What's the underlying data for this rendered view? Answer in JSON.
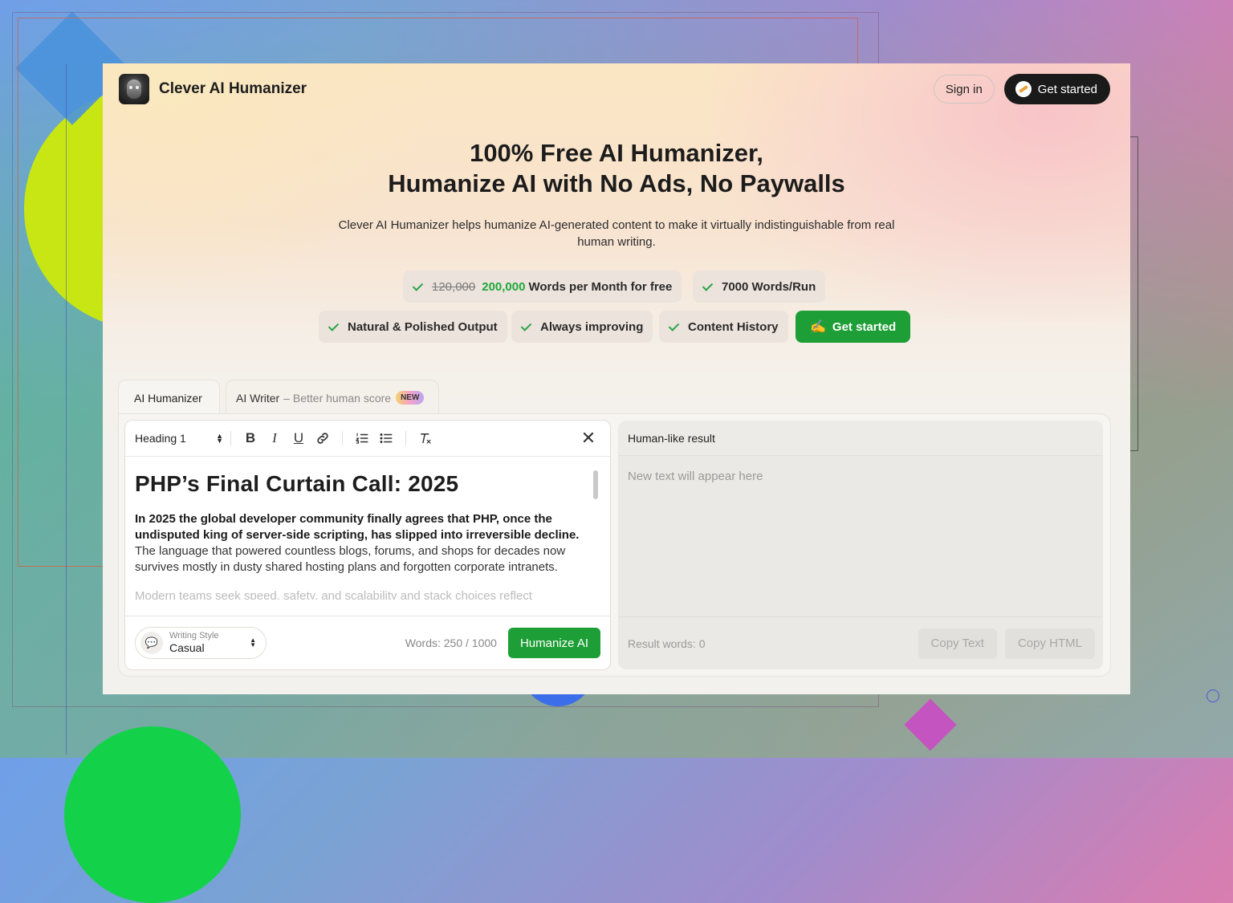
{
  "header": {
    "brand": "Clever AI Humanizer",
    "sign_in": "Sign in",
    "get_started": "Get started"
  },
  "hero": {
    "title_line1": "100% Free AI Humanizer,",
    "title_line2": "Humanize AI with No Ads, No Paywalls",
    "subtitle": "Clever AI Humanizer helps humanize AI-generated content to make it virtually indistinguishable from real human writing."
  },
  "features": {
    "words_old": "120,000",
    "words_new": "200,000",
    "words_suffix": "Words per Month for free",
    "words_run": "7000 Words/Run",
    "natural": "Natural & Polished Output",
    "improving": "Always improving",
    "history": "Content History",
    "cta": "Get started"
  },
  "tabs": {
    "humanizer": "AI Humanizer",
    "writer": "AI Writer",
    "writer_note": "– Better human score",
    "badge": "NEW"
  },
  "editor": {
    "heading_select": "Heading 1",
    "doc_title": "PHP’s Final Curtain Call: 2025",
    "p1_bold": "In 2025 the global developer community finally agrees that PHP, once the undisputed king of server-side scripting, has slipped into irreversible decline.",
    "p1_rest": " The language that powered countless blogs, forums, and shops for decades now survives mostly in dusty shared hosting plans and forgotten corporate intranets.",
    "p2_fragment": "Modern teams seek speed, safety, and scalability and stack choices reflect",
    "style_label": "Writing Style",
    "style_value": "Casual",
    "words": "Words: 250 / 1000",
    "humanize_btn": "Humanize AI"
  },
  "result": {
    "title": "Human-like result",
    "placeholder": "New text will appear here",
    "words": "Result words: 0",
    "copy_text": "Copy Text",
    "copy_html": "Copy HTML"
  },
  "colors": {
    "accent_green": "#1e9e36",
    "dark": "#1a1a1a"
  }
}
